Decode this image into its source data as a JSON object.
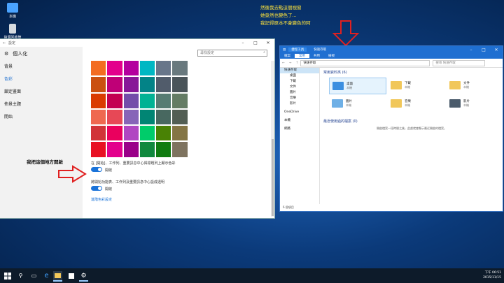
{
  "annotations": {
    "line1": "然後我去點這個視窗",
    "line2": "她竟然也變色了...",
    "line3": "我記得原本不會變色的阿",
    "left_note": "我把這個地方開啟"
  },
  "desktop_icons": [
    {
      "label": "本機",
      "icon": "pc-icon"
    },
    {
      "label": "資源回收筒",
      "icon": "recycle-bin-icon"
    }
  ],
  "settings": {
    "title": "設定",
    "header": "個人化",
    "search_placeholder": "尋找設定",
    "nav": [
      "背景",
      "色彩",
      "鎖定畫面",
      "佈景主題",
      "開始"
    ],
    "active_nav": 1,
    "palette": [
      "#f36c21",
      "#e3008c",
      "#b4009e",
      "#00b7c3",
      "#68768a",
      "#69797e",
      "#ca5010",
      "#bf0077",
      "#881798",
      "#038387",
      "#515c6b",
      "#4a5459",
      "#da3b01",
      "#c30052",
      "#744da9",
      "#00b294",
      "#567c73",
      "#647c64",
      "#ef6950",
      "#e74856",
      "#8764b8",
      "#018574",
      "#486860",
      "#525e54",
      "#d13438",
      "#ea005e",
      "#b146c2",
      "#00cc6a",
      "#498205",
      "#847545",
      "#e81123",
      "#e3008c",
      "#9a0089",
      "#10893e",
      "#107c10",
      "#7e735f"
    ],
    "option1_text": "在 [開始]、工作列、重要訊息中心與標題列上顯示色彩",
    "option1_state": "開啟",
    "option2_text": "將開始功能表、工作列及重要訊息中心設成透明",
    "option2_state": "開啟",
    "link": "進階色彩設定"
  },
  "explorer": {
    "title": "快速存取",
    "tools_tab": "捷徑工具",
    "ribbon": [
      "檔案",
      "常用",
      "共用",
      "檢視"
    ],
    "ribbon_selected": 1,
    "address": "快速存取",
    "search": "搜尋 快速存取",
    "nav": [
      {
        "label": "快速存取",
        "sub": false
      },
      {
        "label": "桌面",
        "sub": true
      },
      {
        "label": "下載",
        "sub": true
      },
      {
        "label": "文件",
        "sub": true
      },
      {
        "label": "圖片",
        "sub": true
      },
      {
        "label": "音樂",
        "sub": true
      },
      {
        "label": "影片",
        "sub": true
      },
      {
        "label": "OneDrive",
        "sub": false
      },
      {
        "label": "本機",
        "sub": false
      },
      {
        "label": "網路",
        "sub": false
      }
    ],
    "frequent_header": "常用資料夾 (6)",
    "folders": [
      {
        "name": "桌面",
        "loc": "本機"
      },
      {
        "name": "下載",
        "loc": "本機"
      },
      {
        "name": "文件",
        "loc": "本機"
      },
      {
        "name": "圖片",
        "loc": "本機"
      },
      {
        "name": "音樂",
        "loc": "本機"
      },
      {
        "name": "影片",
        "loc": "本機"
      }
    ],
    "recent_header": "最近使用過的檔案 (0)",
    "recent_empty": "開啟檔案一段時間之後，此處就會顯示最近開啟的檔案。",
    "status": "6 個項目"
  },
  "taskbar": {
    "time": "下午 06:51",
    "date": "2015/11/15"
  }
}
